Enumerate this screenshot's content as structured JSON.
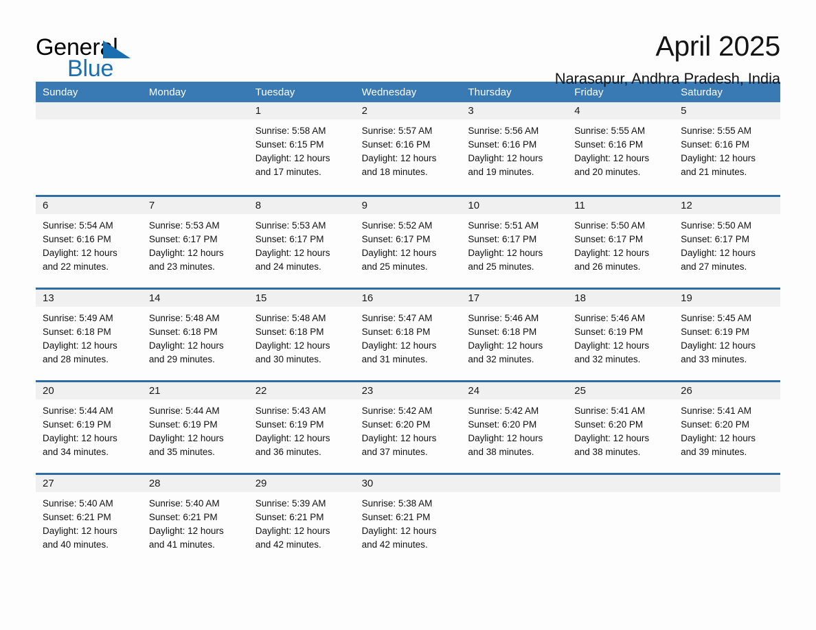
{
  "brand": {
    "name_part1": "General",
    "name_part2": "Blue",
    "accent_color": "#1a6fb0",
    "triangle_icon": "brand-triangle-icon"
  },
  "header": {
    "month_title": "April 2025",
    "location": "Narasapur, Andhra Pradesh, India"
  },
  "calendar": {
    "header_bg": "#3a7ab4",
    "row_divider_color": "#2e6da4",
    "day_number_bg": "#f0f0f0",
    "weekdays": [
      "Sunday",
      "Monday",
      "Tuesday",
      "Wednesday",
      "Thursday",
      "Friday",
      "Saturday"
    ],
    "weeks": [
      [
        {
          "day": "",
          "sunrise": "",
          "sunset": "",
          "daylight": ""
        },
        {
          "day": "",
          "sunrise": "",
          "sunset": "",
          "daylight": ""
        },
        {
          "day": "1",
          "sunrise": "Sunrise: 5:58 AM",
          "sunset": "Sunset: 6:15 PM",
          "daylight": "Daylight: 12 hours and 17 minutes."
        },
        {
          "day": "2",
          "sunrise": "Sunrise: 5:57 AM",
          "sunset": "Sunset: 6:16 PM",
          "daylight": "Daylight: 12 hours and 18 minutes."
        },
        {
          "day": "3",
          "sunrise": "Sunrise: 5:56 AM",
          "sunset": "Sunset: 6:16 PM",
          "daylight": "Daylight: 12 hours and 19 minutes."
        },
        {
          "day": "4",
          "sunrise": "Sunrise: 5:55 AM",
          "sunset": "Sunset: 6:16 PM",
          "daylight": "Daylight: 12 hours and 20 minutes."
        },
        {
          "day": "5",
          "sunrise": "Sunrise: 5:55 AM",
          "sunset": "Sunset: 6:16 PM",
          "daylight": "Daylight: 12 hours and 21 minutes."
        }
      ],
      [
        {
          "day": "6",
          "sunrise": "Sunrise: 5:54 AM",
          "sunset": "Sunset: 6:16 PM",
          "daylight": "Daylight: 12 hours and 22 minutes."
        },
        {
          "day": "7",
          "sunrise": "Sunrise: 5:53 AM",
          "sunset": "Sunset: 6:17 PM",
          "daylight": "Daylight: 12 hours and 23 minutes."
        },
        {
          "day": "8",
          "sunrise": "Sunrise: 5:53 AM",
          "sunset": "Sunset: 6:17 PM",
          "daylight": "Daylight: 12 hours and 24 minutes."
        },
        {
          "day": "9",
          "sunrise": "Sunrise: 5:52 AM",
          "sunset": "Sunset: 6:17 PM",
          "daylight": "Daylight: 12 hours and 25 minutes."
        },
        {
          "day": "10",
          "sunrise": "Sunrise: 5:51 AM",
          "sunset": "Sunset: 6:17 PM",
          "daylight": "Daylight: 12 hours and 25 minutes."
        },
        {
          "day": "11",
          "sunrise": "Sunrise: 5:50 AM",
          "sunset": "Sunset: 6:17 PM",
          "daylight": "Daylight: 12 hours and 26 minutes."
        },
        {
          "day": "12",
          "sunrise": "Sunrise: 5:50 AM",
          "sunset": "Sunset: 6:17 PM",
          "daylight": "Daylight: 12 hours and 27 minutes."
        }
      ],
      [
        {
          "day": "13",
          "sunrise": "Sunrise: 5:49 AM",
          "sunset": "Sunset: 6:18 PM",
          "daylight": "Daylight: 12 hours and 28 minutes."
        },
        {
          "day": "14",
          "sunrise": "Sunrise: 5:48 AM",
          "sunset": "Sunset: 6:18 PM",
          "daylight": "Daylight: 12 hours and 29 minutes."
        },
        {
          "day": "15",
          "sunrise": "Sunrise: 5:48 AM",
          "sunset": "Sunset: 6:18 PM",
          "daylight": "Daylight: 12 hours and 30 minutes."
        },
        {
          "day": "16",
          "sunrise": "Sunrise: 5:47 AM",
          "sunset": "Sunset: 6:18 PM",
          "daylight": "Daylight: 12 hours and 31 minutes."
        },
        {
          "day": "17",
          "sunrise": "Sunrise: 5:46 AM",
          "sunset": "Sunset: 6:18 PM",
          "daylight": "Daylight: 12 hours and 32 minutes."
        },
        {
          "day": "18",
          "sunrise": "Sunrise: 5:46 AM",
          "sunset": "Sunset: 6:19 PM",
          "daylight": "Daylight: 12 hours and 32 minutes."
        },
        {
          "day": "19",
          "sunrise": "Sunrise: 5:45 AM",
          "sunset": "Sunset: 6:19 PM",
          "daylight": "Daylight: 12 hours and 33 minutes."
        }
      ],
      [
        {
          "day": "20",
          "sunrise": "Sunrise: 5:44 AM",
          "sunset": "Sunset: 6:19 PM",
          "daylight": "Daylight: 12 hours and 34 minutes."
        },
        {
          "day": "21",
          "sunrise": "Sunrise: 5:44 AM",
          "sunset": "Sunset: 6:19 PM",
          "daylight": "Daylight: 12 hours and 35 minutes."
        },
        {
          "day": "22",
          "sunrise": "Sunrise: 5:43 AM",
          "sunset": "Sunset: 6:19 PM",
          "daylight": "Daylight: 12 hours and 36 minutes."
        },
        {
          "day": "23",
          "sunrise": "Sunrise: 5:42 AM",
          "sunset": "Sunset: 6:20 PM",
          "daylight": "Daylight: 12 hours and 37 minutes."
        },
        {
          "day": "24",
          "sunrise": "Sunrise: 5:42 AM",
          "sunset": "Sunset: 6:20 PM",
          "daylight": "Daylight: 12 hours and 38 minutes."
        },
        {
          "day": "25",
          "sunrise": "Sunrise: 5:41 AM",
          "sunset": "Sunset: 6:20 PM",
          "daylight": "Daylight: 12 hours and 38 minutes."
        },
        {
          "day": "26",
          "sunrise": "Sunrise: 5:41 AM",
          "sunset": "Sunset: 6:20 PM",
          "daylight": "Daylight: 12 hours and 39 minutes."
        }
      ],
      [
        {
          "day": "27",
          "sunrise": "Sunrise: 5:40 AM",
          "sunset": "Sunset: 6:21 PM",
          "daylight": "Daylight: 12 hours and 40 minutes."
        },
        {
          "day": "28",
          "sunrise": "Sunrise: 5:40 AM",
          "sunset": "Sunset: 6:21 PM",
          "daylight": "Daylight: 12 hours and 41 minutes."
        },
        {
          "day": "29",
          "sunrise": "Sunrise: 5:39 AM",
          "sunset": "Sunset: 6:21 PM",
          "daylight": "Daylight: 12 hours and 42 minutes."
        },
        {
          "day": "30",
          "sunrise": "Sunrise: 5:38 AM",
          "sunset": "Sunset: 6:21 PM",
          "daylight": "Daylight: 12 hours and 42 minutes."
        },
        {
          "day": "",
          "sunrise": "",
          "sunset": "",
          "daylight": ""
        },
        {
          "day": "",
          "sunrise": "",
          "sunset": "",
          "daylight": ""
        },
        {
          "day": "",
          "sunrise": "",
          "sunset": "",
          "daylight": ""
        }
      ]
    ]
  }
}
